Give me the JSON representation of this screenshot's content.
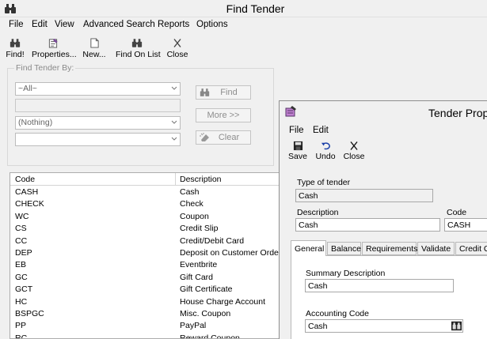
{
  "window": {
    "title": "Find Tender"
  },
  "menu": [
    "File",
    "Edit",
    "View",
    "Advanced Search",
    "Reports",
    "Options"
  ],
  "toolbar": {
    "find": "Find!",
    "properties": "Properties...",
    "new": "New...",
    "find_on_list": "Find On List",
    "close": "Close"
  },
  "find_panel": {
    "legend": "Find Tender By:",
    "combo1": "~All~",
    "combo2": "(Nothing)",
    "combo3": "",
    "find_btn": "Find",
    "more_btn": "More >>",
    "clear_btn": "Clear"
  },
  "list": {
    "columns": [
      "Code",
      "Description"
    ],
    "rows": [
      [
        "CASH",
        "Cash"
      ],
      [
        "CHECK",
        "Check"
      ],
      [
        "WC",
        "Coupon"
      ],
      [
        "CS",
        "Credit Slip"
      ],
      [
        "CC",
        "Credit/Debit Card"
      ],
      [
        "DEP",
        "Deposit on Customer Order"
      ],
      [
        "EB",
        "Eventbrite"
      ],
      [
        "GC",
        "Gift Card"
      ],
      [
        "GCT",
        "Gift Certificate"
      ],
      [
        "HC",
        "House Charge Account"
      ],
      [
        "BSPGC",
        "Misc. Coupon"
      ],
      [
        "PP",
        "PayPal"
      ],
      [
        "RC",
        "Reward Coupon"
      ]
    ]
  },
  "dialog": {
    "title": "Tender Prope",
    "menu": [
      "File",
      "Edit"
    ],
    "toolbar": {
      "save": "Save",
      "undo": "Undo",
      "close": "Close"
    },
    "type_label": "Type of tender",
    "type_value": "Cash",
    "description_label": "Description",
    "description_value": "Cash",
    "code_label": "Code",
    "code_value": "CASH",
    "tabs": [
      "General",
      "Balance",
      "Requirements",
      "Validate",
      "Credit Ca"
    ],
    "summary_label": "Summary Description",
    "summary_value": "Cash",
    "accounting_label": "Accounting Code",
    "accounting_value": "Cash"
  }
}
